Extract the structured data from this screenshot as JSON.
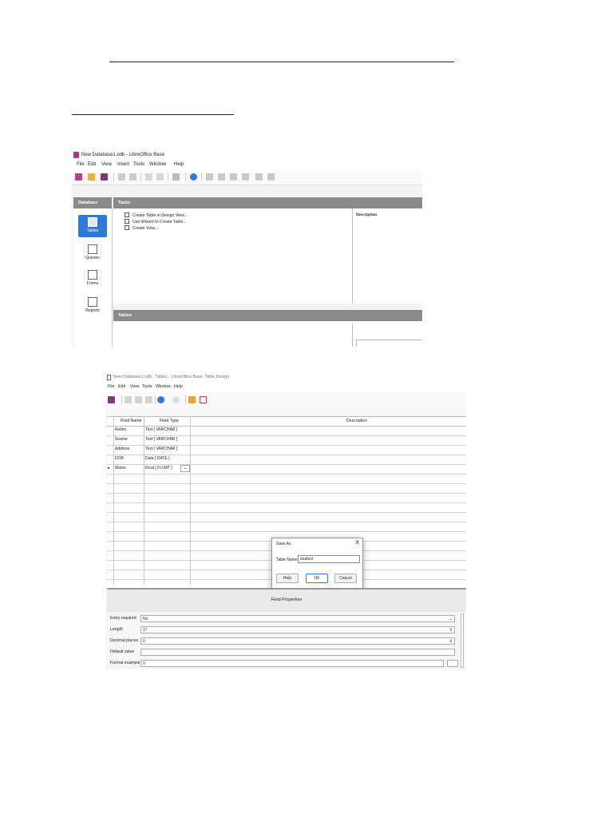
{
  "window1": {
    "title": "New Database1.odb - LibreOffice Base",
    "menu": [
      "File",
      "Edit",
      "View",
      "Insert",
      "Tools",
      "Window",
      "Help"
    ],
    "database_header": "Database",
    "tasks_header": "Tasks",
    "description_header": "Description",
    "tables_header": "Tables",
    "nav_items": [
      "Tables",
      "Queries",
      "Forms",
      "Reports"
    ],
    "tasks": [
      "Create Table in Design View...",
      "Use Wizard to Create Table...",
      "Create View..."
    ]
  },
  "window2": {
    "title": "New Database1.odb : Table1 - LibreOffice Base: Table Design",
    "menu": [
      "File",
      "Edit",
      "View",
      "Tools",
      "Window",
      "Help"
    ],
    "columns": [
      "Field Name",
      "Field Type",
      "Description"
    ],
    "rows": [
      {
        "name": "Rollno",
        "type": "Text [ VARCHAR ]"
      },
      {
        "name": "Sname",
        "type": "Text [ VARCHAR ]"
      },
      {
        "name": "Address",
        "type": "Text [ VARCHAR ]"
      },
      {
        "name": "DOB",
        "type": "Date [ DATE ]"
      },
      {
        "name": "Marks",
        "type": "Float [ FLOAT ]"
      }
    ],
    "field_properties_label": "Field Properties",
    "properties": [
      {
        "label": "Entry required",
        "value": "No"
      },
      {
        "label": "Length",
        "value": "17"
      },
      {
        "label": "Decimal places",
        "value": "0"
      },
      {
        "label": "Default value",
        "value": ""
      },
      {
        "label": "Format example",
        "value": "0"
      }
    ],
    "dialog": {
      "title": "Save As",
      "close": "X",
      "label": "Table Name:",
      "value": "student",
      "buttons": [
        "Help",
        "OK",
        "Cancel"
      ]
    }
  }
}
